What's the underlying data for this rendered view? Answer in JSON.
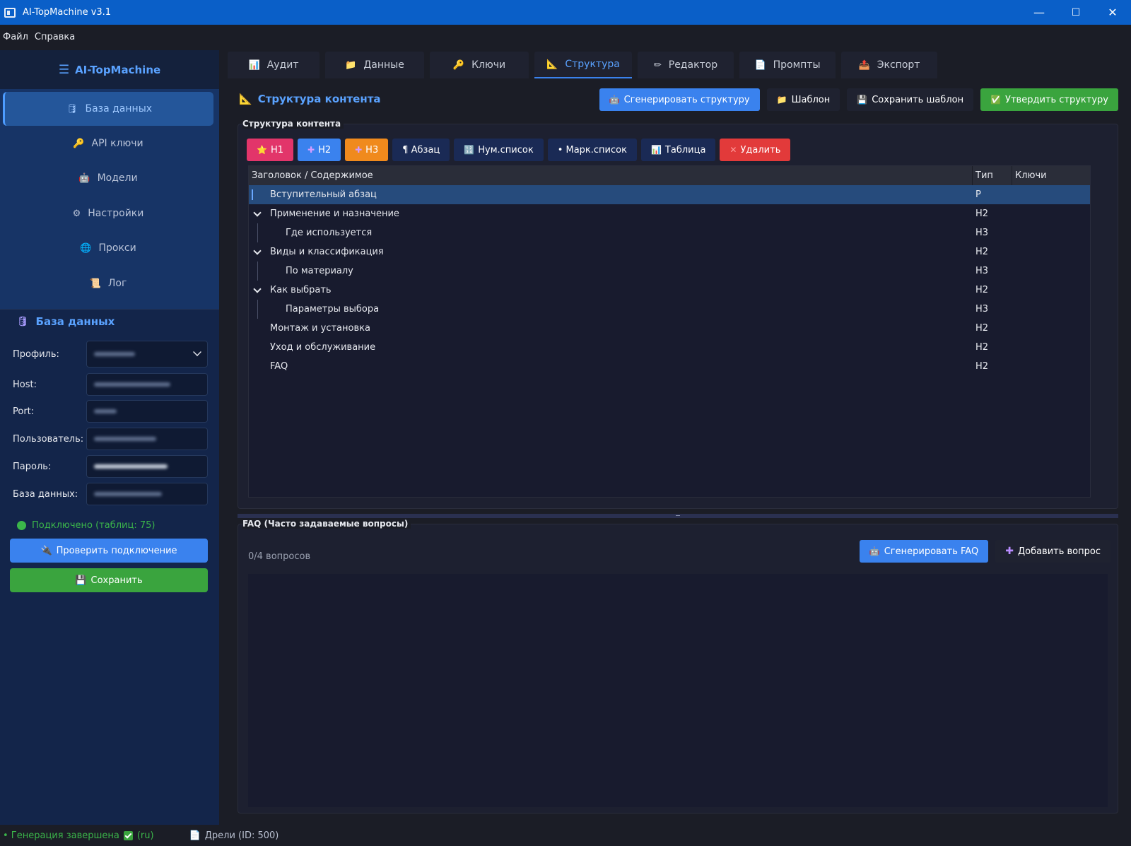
{
  "window": {
    "title": "AI-TopMachine v3.1",
    "minimize": "—",
    "maximize": "☐",
    "close": "✕"
  },
  "menu": [
    "Файл",
    "Справка"
  ],
  "sidebar": {
    "brand": "AI-TopMachine",
    "nav": [
      {
        "label": "База данных",
        "icon": "🛢"
      },
      {
        "label": "API ключи",
        "icon": "🔑"
      },
      {
        "label": "Модели",
        "icon": "🤖"
      },
      {
        "label": "Настройки",
        "icon": "⚙"
      },
      {
        "label": "Прокси",
        "icon": "🌐"
      },
      {
        "label": "Лог",
        "icon": "📜"
      }
    ],
    "db_panel": {
      "title": "База данных",
      "fields": [
        "Профиль:",
        "Host:",
        "Port:",
        "Пользователь:",
        "Пароль:",
        "База данных:"
      ],
      "status": "Подключено (таблиц: 75)",
      "check_button": "Проверить подключение",
      "save_button": "Сохранить"
    }
  },
  "tabs": [
    {
      "label": "Аудит",
      "icon": "📊"
    },
    {
      "label": "Данные",
      "icon": "📁"
    },
    {
      "label": "Ключи",
      "icon": "🔑"
    },
    {
      "label": "Структура",
      "icon": "📐"
    },
    {
      "label": "Редактор",
      "icon": "✏"
    },
    {
      "label": "Промпты",
      "icon": "📄"
    },
    {
      "label": "Экспорт",
      "icon": "📤"
    }
  ],
  "structure": {
    "title": "Структура контента",
    "actions": {
      "generate": "Сгенерировать структуру",
      "template": "Шаблон",
      "save_template": "Сохранить шаблон",
      "approve": "Утвердить структуру"
    },
    "group_label": "Структура контента",
    "toolbar": {
      "h1": "H1",
      "h2": "H2",
      "h3": "H3",
      "paragraph": "¶ Абзац",
      "numbered": "Нум.список",
      "bulleted": "• Марк.список",
      "table": "Таблица",
      "delete": "Удалить"
    },
    "columns": [
      "Заголовок / Содержимое",
      "Тип",
      "Ключи"
    ],
    "rows": [
      {
        "title": "Вступительный абзац",
        "type": "P"
      },
      {
        "title": "Применение и назначение",
        "type": "H2"
      },
      {
        "title": "Где используется",
        "type": "H3"
      },
      {
        "title": "Виды и классификация",
        "type": "H2"
      },
      {
        "title": "По материалу",
        "type": "H3"
      },
      {
        "title": "Как выбрать",
        "type": "H2"
      },
      {
        "title": "Параметры выбора",
        "type": "H3"
      },
      {
        "title": "Монтаж и установка",
        "type": "H2"
      },
      {
        "title": "Уход и обслуживание",
        "type": "H2"
      },
      {
        "title": "FAQ",
        "type": "H2"
      }
    ]
  },
  "faq": {
    "group_label": "FAQ (Часто задаваемые вопросы)",
    "count": "0/4 вопросов",
    "generate": "Сгенерировать FAQ",
    "add": "Добавить вопрос"
  },
  "statusbar": {
    "status": "• Генерация завершена",
    "lang": "(ru)",
    "doc": "Дрели (ID: 500)"
  },
  "colors": {
    "accent": "#3a82ee",
    "success": "#3aa43e",
    "danger": "#e23a3a",
    "h1": "#e2356a",
    "h3": "#f08a1d"
  }
}
